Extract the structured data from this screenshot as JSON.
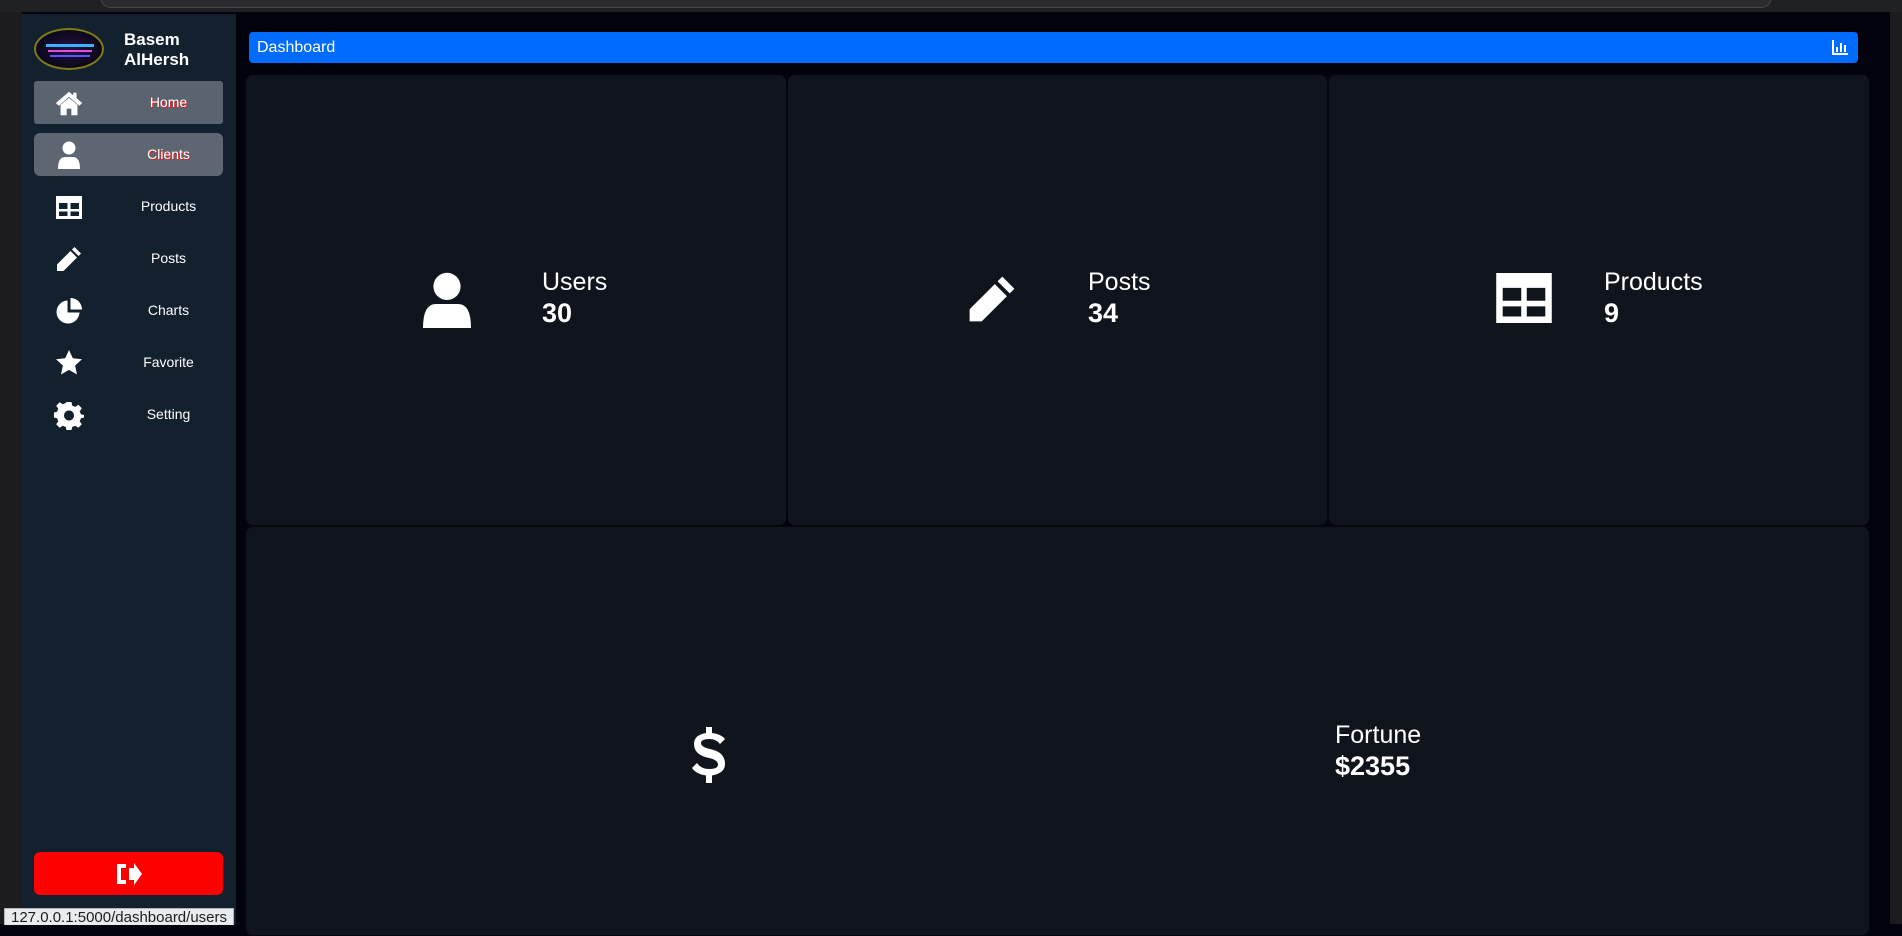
{
  "profile": {
    "name": "Basem AlHersh"
  },
  "nav": [
    {
      "label": "Home",
      "icon": "home-icon"
    },
    {
      "label": "Clients",
      "icon": "user-icon"
    },
    {
      "label": "Products",
      "icon": "table-icon"
    },
    {
      "label": "Posts",
      "icon": "pencil-icon"
    },
    {
      "label": "Charts",
      "icon": "pie-chart-icon"
    },
    {
      "label": "Favorite",
      "icon": "star-icon"
    },
    {
      "label": "Setting",
      "icon": "gear-icon"
    }
  ],
  "header": {
    "title": "Dashboard",
    "icon": "bar-chart-icon",
    "color": "#006bff"
  },
  "cards": {
    "users": {
      "label": "Users",
      "value": "30",
      "icon": "user-icon"
    },
    "posts": {
      "label": "Posts",
      "value": "34",
      "icon": "pencil-icon"
    },
    "products": {
      "label": "Products",
      "value": "9",
      "icon": "table-icon"
    },
    "fortune": {
      "label": "Fortune",
      "value": "$2355",
      "icon": "dollar-icon"
    }
  },
  "logout": {
    "icon": "sign-out-icon",
    "color": "#fd0101"
  },
  "status_bar": {
    "url": "127.0.0.1:5000/dashboard/users"
  }
}
